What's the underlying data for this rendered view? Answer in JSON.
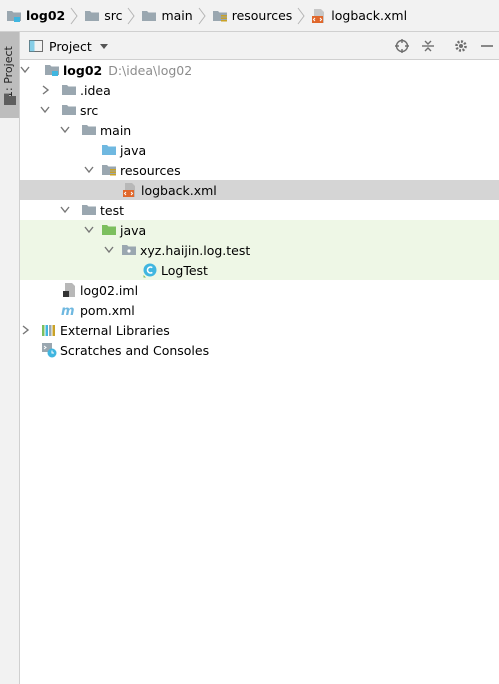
{
  "breadcrumb": {
    "items": [
      {
        "label": "log02",
        "icon": "module-folder-icon"
      },
      {
        "label": "src",
        "icon": "folder-icon"
      },
      {
        "label": "main",
        "icon": "folder-icon"
      },
      {
        "label": "resources",
        "icon": "resources-folder-icon"
      },
      {
        "label": "logback.xml",
        "icon": "xml-file-icon"
      }
    ]
  },
  "tool_strip": {
    "project_tab_label": "1: Project"
  },
  "header": {
    "view_label": "Project",
    "buttons": [
      "locate-icon",
      "collapse-all-icon",
      "gear-icon",
      "minimize-icon"
    ]
  },
  "tree": {
    "root_label": "log02",
    "root_path": "D:\\idea\\log02",
    "idea_label": ".idea",
    "src_label": "src",
    "main_label": "main",
    "main_java_label": "java",
    "resources_label": "resources",
    "logback_label": "logback.xml",
    "test_label": "test",
    "test_java_label": "java",
    "package_label": "xyz.haijin.log.test",
    "logtest_label": "LogTest",
    "iml_label": "log02.iml",
    "pom_label": "pom.xml",
    "ext_libs_label": "External Libraries",
    "scratches_label": "Scratches and Consoles"
  },
  "colors": {
    "folder": "#9aa7b0",
    "source_folder": "#6fb8e0",
    "test_folder": "#7cbf5e",
    "selection": "#d5d5d5",
    "test_row_bg": "#eef7e6",
    "xml_accent": "#e0672b",
    "class_icon": "#40b6e0"
  }
}
